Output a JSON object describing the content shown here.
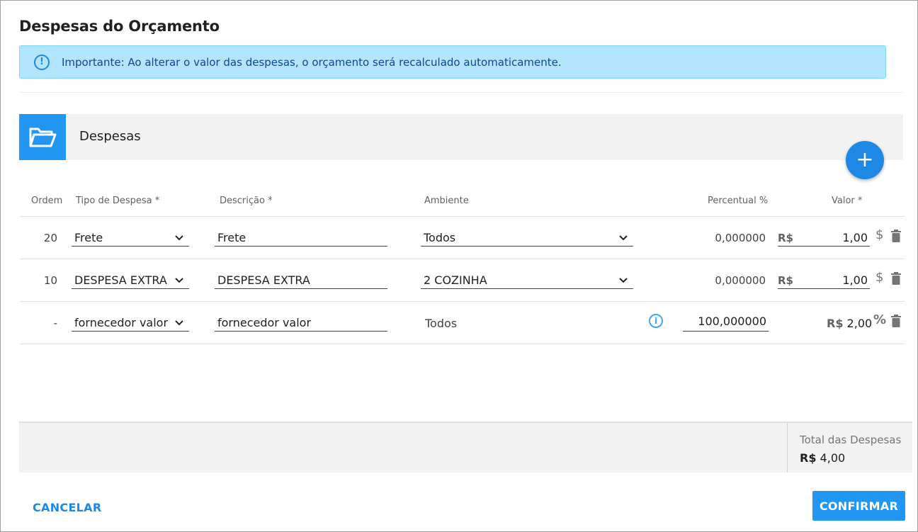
{
  "dialog": {
    "title": "Despesas do Orçamento",
    "alert_icon": "!",
    "alert_text": "Importante: Ao alterar o valor das despesas, o orçamento será recalculado automaticamente."
  },
  "section": {
    "title": "Despesas",
    "icon": "folder-open-icon",
    "add_icon": "+"
  },
  "table": {
    "headers": {
      "order": "Ordem",
      "type": "Tipo de Despesa *",
      "description": "Descrição *",
      "environment": "Ambiente",
      "percent": "Percentual %",
      "value": "Valor *"
    },
    "rows": [
      {
        "order": "20",
        "type": "Frete",
        "description": "Frete",
        "environment": "Todos",
        "percent": "0,000000",
        "currency": "R$",
        "value": "1,00",
        "action_icon": "$",
        "delete_icon": "trash-icon"
      },
      {
        "order": "10",
        "type": "DESPESA EXTRA",
        "description": "DESPESA EXTRA",
        "environment": "2 COZINHA",
        "percent": "0,000000",
        "currency": "R$",
        "value": "1,00",
        "action_icon": "$",
        "delete_icon": "trash-icon"
      },
      {
        "order": "-",
        "type": "fornecedor valor",
        "description": "fornecedor valor",
        "environment": "Todos",
        "info_icon": "i",
        "percent": "100,000000",
        "currency": "R$",
        "value": "2,00",
        "action_icon": "%",
        "delete_icon": "trash-icon"
      }
    ]
  },
  "footer": {
    "total_label": "Total das Despesas",
    "total_currency": "R$",
    "total_value": "4,00"
  },
  "actions": {
    "cancel": "CANCELAR",
    "confirm": "CONFIRMAR"
  },
  "colors": {
    "primary": "#2196f3",
    "alert_bg": "#b3e5fc",
    "alert_text": "#0d47a1"
  }
}
